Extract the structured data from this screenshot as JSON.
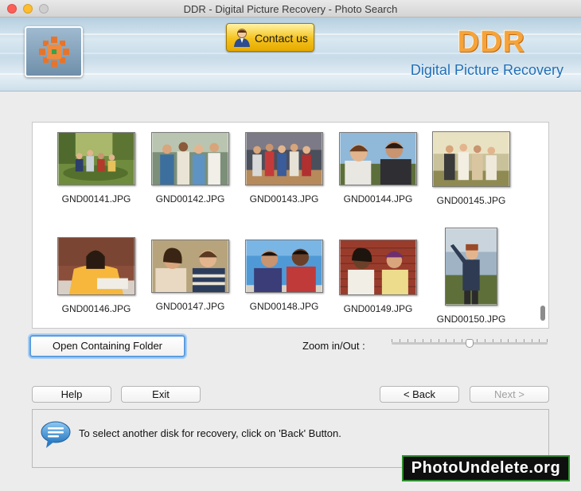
{
  "window": {
    "title": "DDR - Digital Picture Recovery - Photo Search"
  },
  "header": {
    "contact_label": "Contact us",
    "brand": "DDR",
    "subtitle": "Digital Picture Recovery"
  },
  "gallery": {
    "items": [
      {
        "filename": "GND00141.JPG"
      },
      {
        "filename": "GND00142.JPG"
      },
      {
        "filename": "GND00143.JPG"
      },
      {
        "filename": "GND00144.JPG"
      },
      {
        "filename": "GND00145.JPG"
      },
      {
        "filename": "GND00146.JPG"
      },
      {
        "filename": "GND00147.JPG"
      },
      {
        "filename": "GND00148.JPG"
      },
      {
        "filename": "GND00149.JPG"
      },
      {
        "filename": "GND00150.JPG"
      }
    ]
  },
  "controls": {
    "open_folder_label": "Open Containing Folder",
    "zoom_label": "Zoom in/Out :",
    "zoom_level": 0.5
  },
  "footer": {
    "help_label": "Help",
    "exit_label": "Exit",
    "back_label": "< Back",
    "next_label": "Next >"
  },
  "info": {
    "message": "To select another disk for recovery, click on 'Back' Button."
  },
  "watermark": {
    "text": "PhotoUndelete.org"
  },
  "colors": {
    "brand_orange": "#f5a33a",
    "subtitle_blue": "#1f6fb8",
    "contact_gold": "#f4c21c",
    "focus_blue": "#5b9ddf"
  }
}
